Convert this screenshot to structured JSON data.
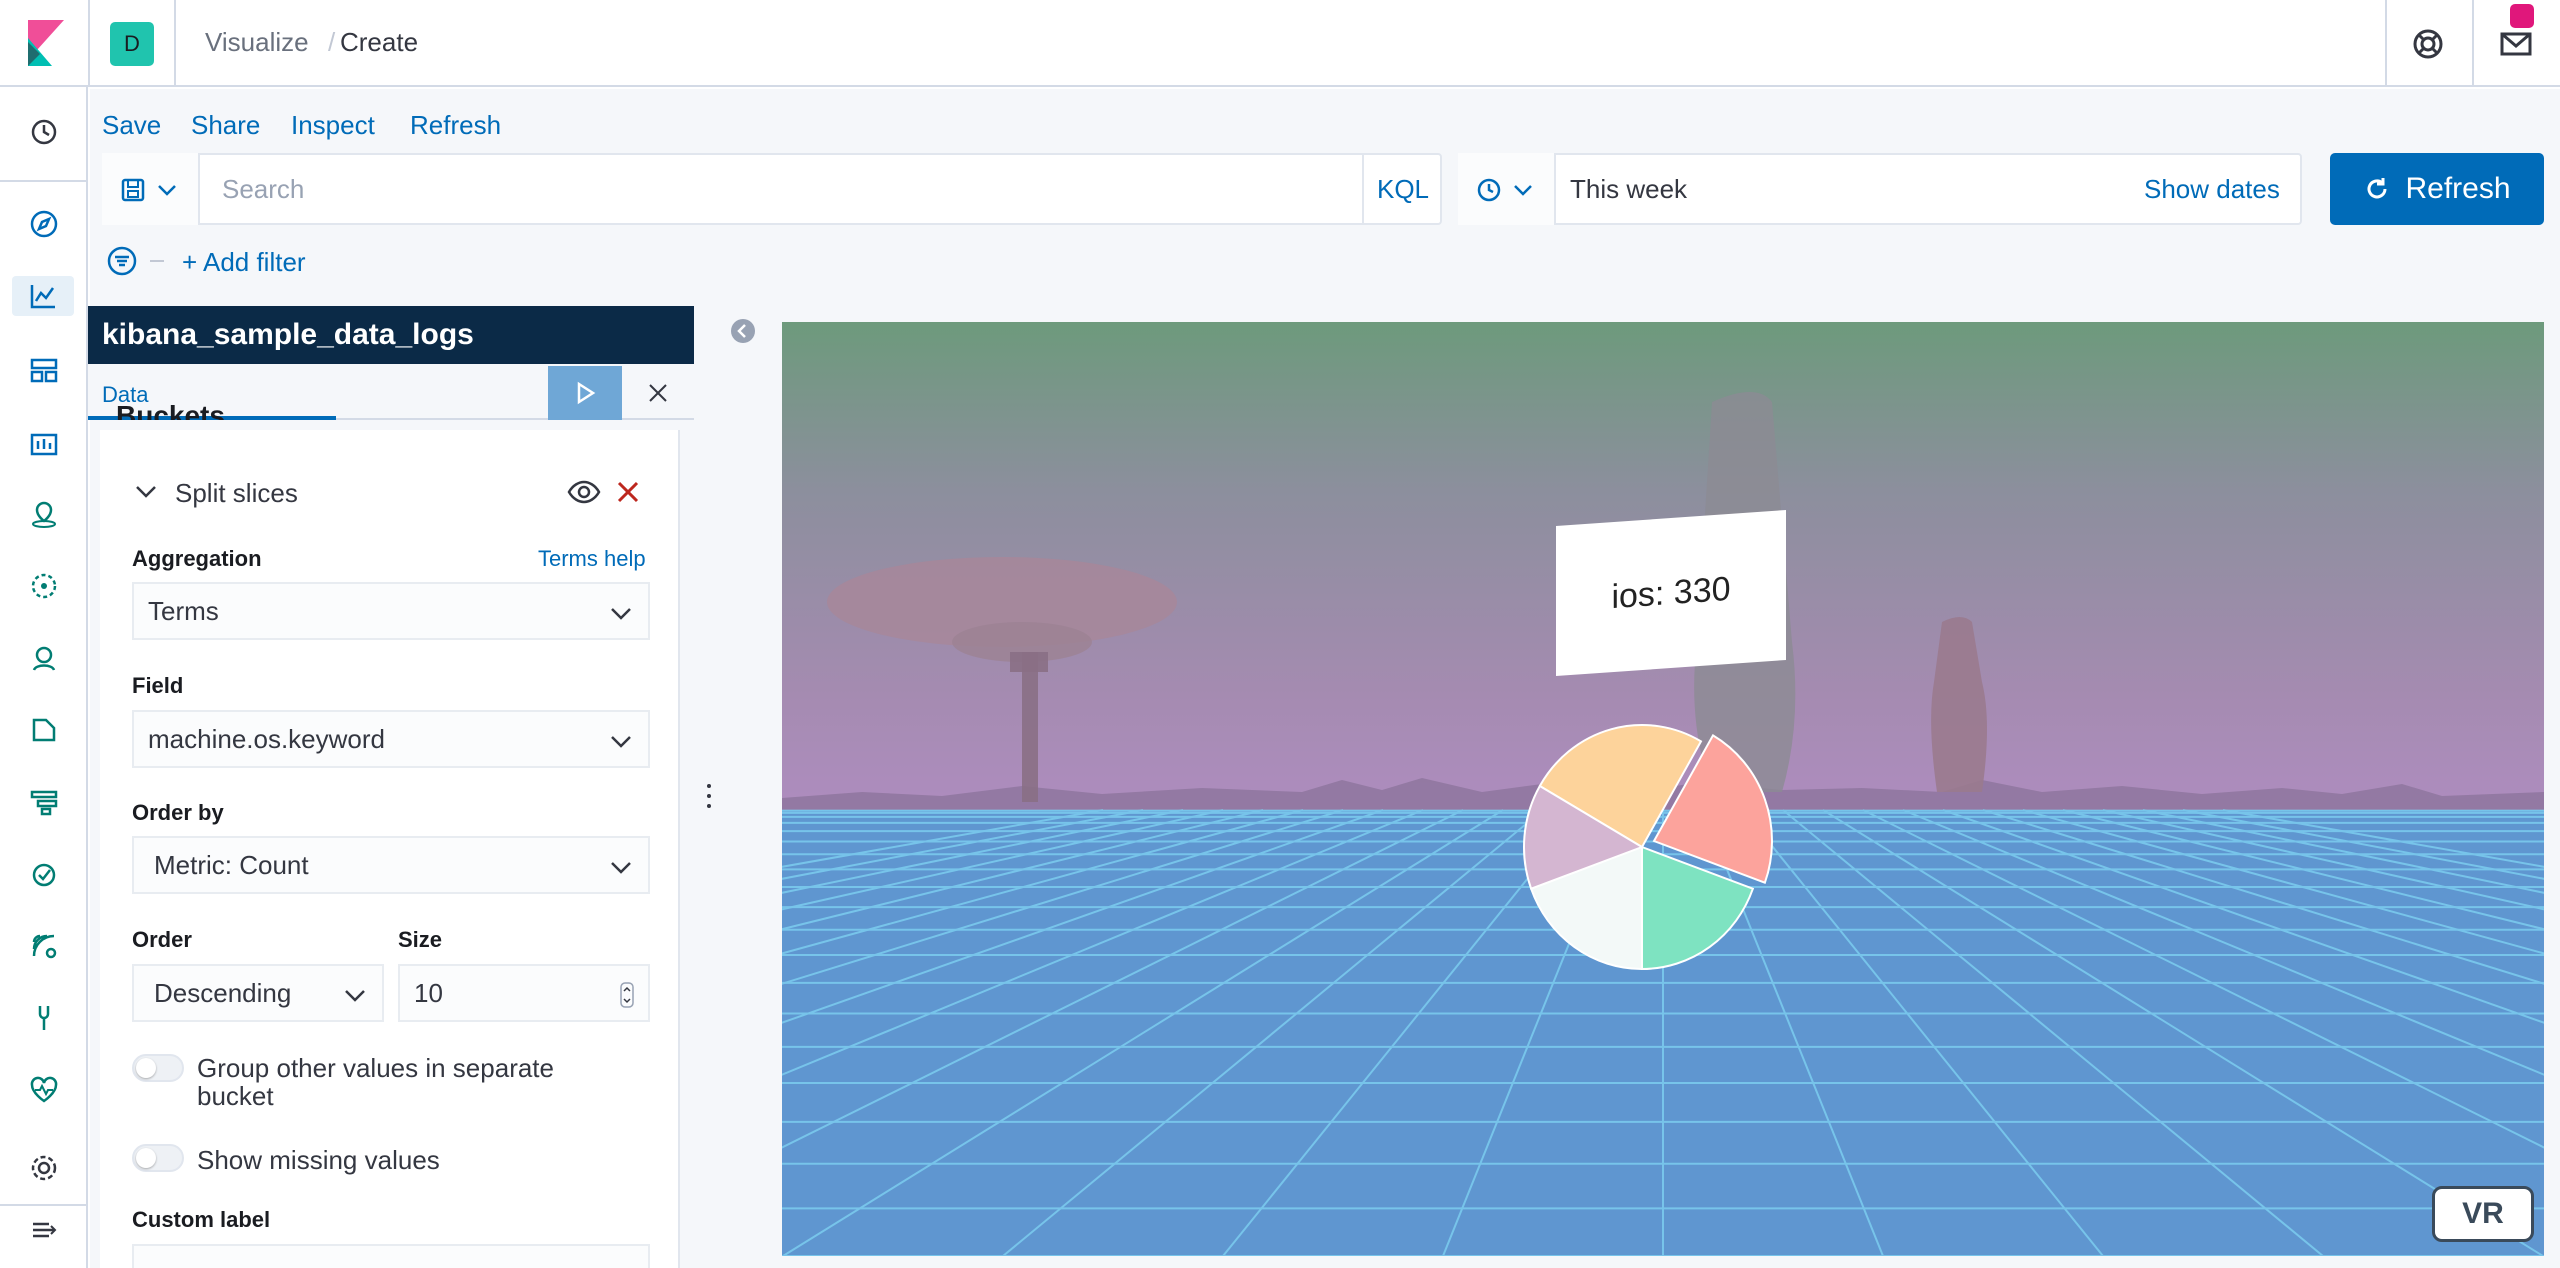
{
  "header": {
    "space_initial": "D",
    "breadcrumb_parent": "Visualize",
    "breadcrumb_separator": "/",
    "breadcrumb_current": "Create"
  },
  "top_menu": {
    "save": "Save",
    "share": "Share",
    "inspect": "Inspect",
    "refresh": "Refresh"
  },
  "query_bar": {
    "search_placeholder": "Search",
    "language": "KQL",
    "date_range": "This week",
    "show_dates": "Show dates",
    "refresh_button": "Refresh"
  },
  "filters": {
    "add_filter": "+ Add filter"
  },
  "editor": {
    "index_pattern": "kibana_sample_data_logs",
    "tab_data": "Data",
    "section_title": "Buckets",
    "bucket_title": "Split slices",
    "aggregation_label": "Aggregation",
    "aggregation_help": "Terms help",
    "aggregation_value": "Terms",
    "field_label": "Field",
    "field_value": "machine.os.keyword",
    "order_by_label": "Order by",
    "order_by_value": "Metric: Count",
    "order_label": "Order",
    "order_value": "Descending",
    "size_label": "Size",
    "size_value": "10",
    "group_other_label": "Group other values in separate bucket",
    "show_missing_label": "Show missing values",
    "custom_label": "Custom label",
    "group_other_enabled": false,
    "show_missing_enabled": false
  },
  "viewport": {
    "tooltip_text": "ios: 330",
    "vr_button": "VR",
    "pie_colors": [
      "#fdd39b",
      "#fca39c",
      "#7ee3c1",
      "#f3f9f8",
      "#d4b6d1"
    ]
  },
  "colors": {
    "accent": "#006bb8",
    "panel_header": "#0b2a47",
    "space_badge": "#20c4ae",
    "notification": "#e0177b"
  }
}
